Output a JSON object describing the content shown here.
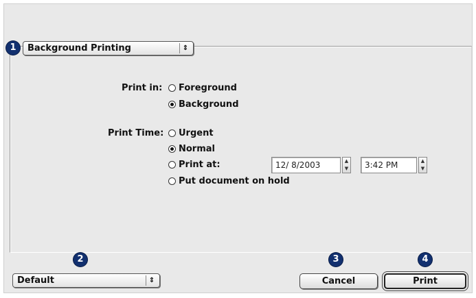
{
  "panel_popup": {
    "label": "Background Printing",
    "arrows": "⇕"
  },
  "print_in": {
    "label": "Print in:",
    "options": [
      {
        "label": "Foreground",
        "selected": false
      },
      {
        "label": "Background",
        "selected": true
      }
    ]
  },
  "print_time": {
    "label": "Print Time:",
    "options": [
      {
        "label": "Urgent",
        "selected": false
      },
      {
        "label": "Normal",
        "selected": true
      },
      {
        "label": "Print at:",
        "selected": false
      },
      {
        "label": "Put document on hold",
        "selected": false
      }
    ],
    "date_value": "12/  8/2003",
    "time_value": "3:42 PM"
  },
  "preset_popup": {
    "label": "Default",
    "arrows": "⇕"
  },
  "buttons": {
    "cancel": "Cancel",
    "print": "Print"
  },
  "callouts": [
    "1",
    "2",
    "3",
    "4"
  ],
  "colors": {
    "callout_badge": "#12306f",
    "dialog_bg": "#e9e9e9"
  }
}
